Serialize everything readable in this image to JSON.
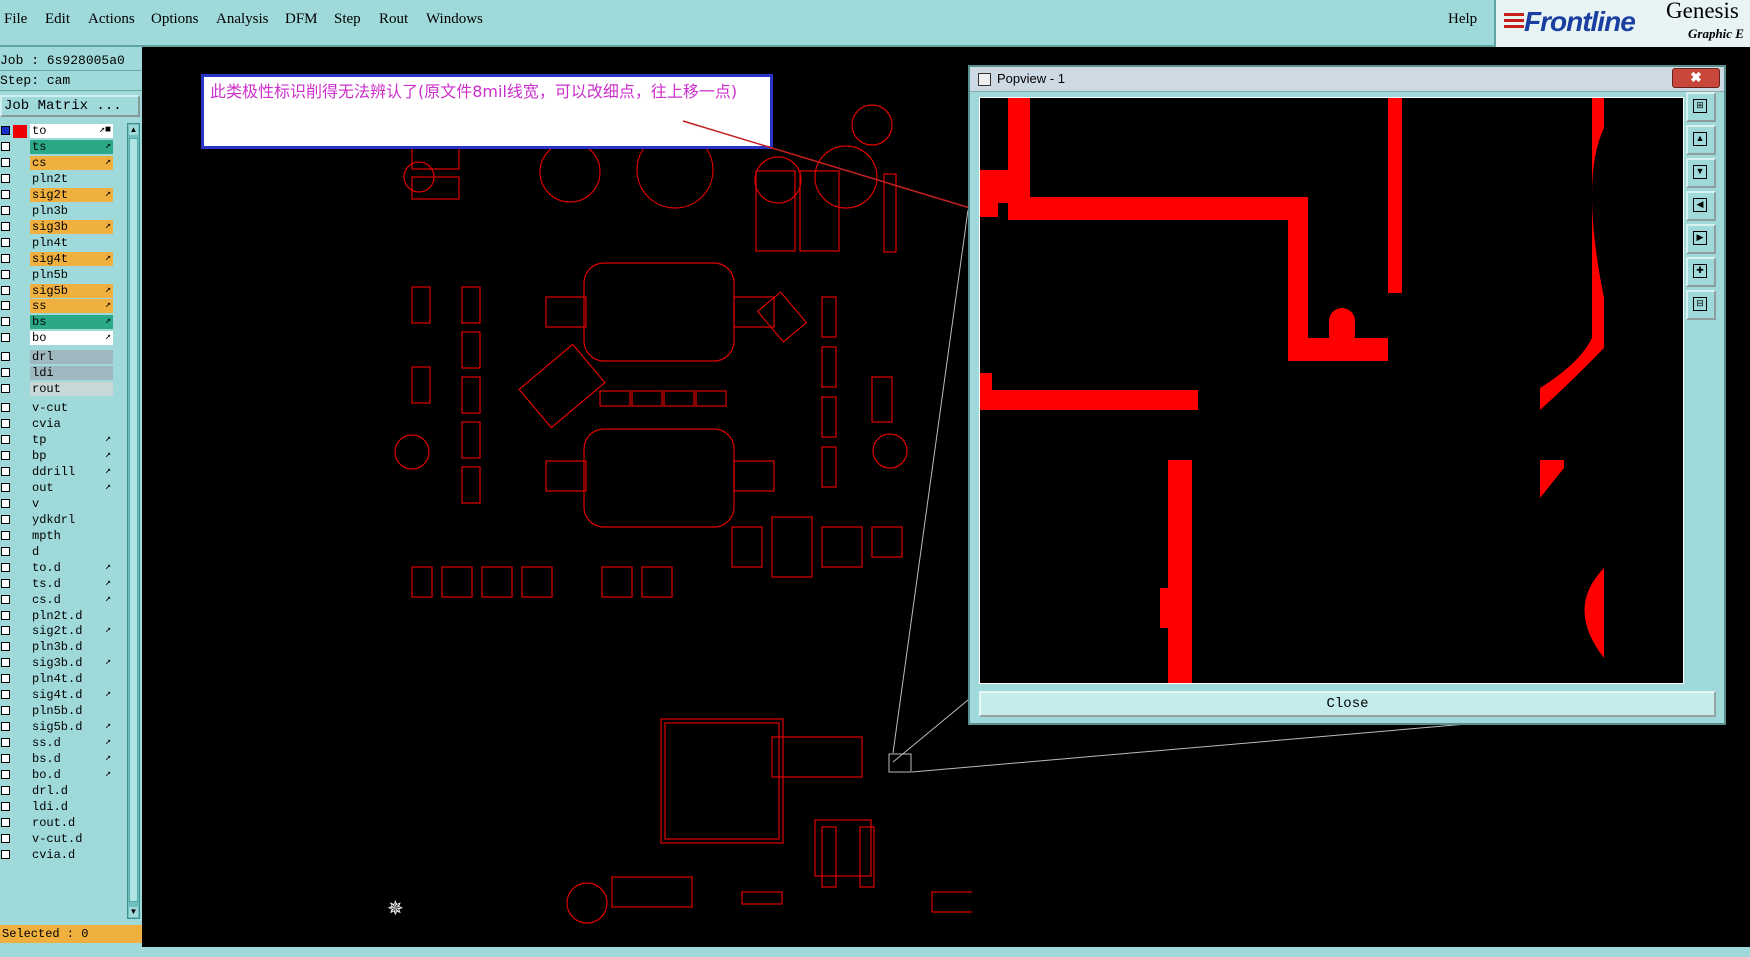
{
  "menubar": {
    "items": [
      "File",
      "Edit",
      "Actions",
      "Options",
      "Analysis",
      "DFM",
      "Step",
      "Rout",
      "Windows"
    ],
    "help": "Help",
    "brand": "Frontline",
    "product": "Genesis",
    "product_sub": "Graphic E"
  },
  "left_panel": {
    "job": "Job : 6s928005a0",
    "step": "Step: cam",
    "job_matrix": "Job Matrix ...",
    "selected": "Selected : 0",
    "layers": [
      {
        "name": "to",
        "color": "#ffffff",
        "active": true,
        "arrow": "↗■"
      },
      {
        "name": "ts",
        "color": "#2aa888",
        "arrow": "↗"
      },
      {
        "name": "cs",
        "color": "#f0b040",
        "arrow": "↗"
      },
      {
        "name": "pln2t",
        "color": "#9fd9d9",
        "arrow": ""
      },
      {
        "name": "sig2t",
        "color": "#f0b040",
        "arrow": "↗"
      },
      {
        "name": "pln3b",
        "color": "#9fd9d9",
        "arrow": ""
      },
      {
        "name": "sig3b",
        "color": "#f0b040",
        "arrow": "↗"
      },
      {
        "name": "pln4t",
        "color": "#9fd9d9",
        "arrow": ""
      },
      {
        "name": "sig4t",
        "color": "#f0b040",
        "arrow": "↗"
      },
      {
        "name": "pln5b",
        "color": "#9fd9d9",
        "arrow": ""
      },
      {
        "name": "sig5b",
        "color": "#f0b040",
        "arrow": "↗"
      },
      {
        "name": "ss",
        "color": "#f0b040",
        "arrow": "↗"
      },
      {
        "name": "bs",
        "color": "#2aa888",
        "arrow": "↗"
      },
      {
        "name": "bo",
        "color": "#ffffff",
        "arrow": "↗"
      },
      {
        "name": "drl",
        "color": "#9fb8c0",
        "arrow": ""
      },
      {
        "name": "ldi",
        "color": "#9fb8c0",
        "arrow": ""
      },
      {
        "name": "rout",
        "color": "#c8d8d8",
        "arrow": ""
      },
      {
        "name": "v-cut",
        "color": "#9fd9d9",
        "arrow": ""
      },
      {
        "name": "cvia",
        "color": "#9fd9d9",
        "arrow": ""
      },
      {
        "name": "tp",
        "color": "#9fd9d9",
        "arrow": "↗"
      },
      {
        "name": "bp",
        "color": "#9fd9d9",
        "arrow": "↗"
      },
      {
        "name": "ddrill",
        "color": "#9fd9d9",
        "arrow": "↗"
      },
      {
        "name": "out",
        "color": "#9fd9d9",
        "arrow": "↗"
      },
      {
        "name": "v",
        "color": "#9fd9d9",
        "arrow": ""
      },
      {
        "name": "ydkdrl",
        "color": "#9fd9d9",
        "arrow": ""
      },
      {
        "name": "mpth",
        "color": "#9fd9d9",
        "arrow": ""
      },
      {
        "name": "d",
        "color": "#9fd9d9",
        "arrow": ""
      },
      {
        "name": "to.d",
        "color": "#9fd9d9",
        "arrow": "↗"
      },
      {
        "name": "ts.d",
        "color": "#9fd9d9",
        "arrow": "↗"
      },
      {
        "name": "cs.d",
        "color": "#9fd9d9",
        "arrow": "↗"
      },
      {
        "name": "pln2t.d",
        "color": "#9fd9d9",
        "arrow": ""
      },
      {
        "name": "sig2t.d",
        "color": "#9fd9d9",
        "arrow": "↗"
      },
      {
        "name": "pln3b.d",
        "color": "#9fd9d9",
        "arrow": ""
      },
      {
        "name": "sig3b.d",
        "color": "#9fd9d9",
        "arrow": "↗"
      },
      {
        "name": "pln4t.d",
        "color": "#9fd9d9",
        "arrow": ""
      },
      {
        "name": "sig4t.d",
        "color": "#9fd9d9",
        "arrow": "↗"
      },
      {
        "name": "pln5b.d",
        "color": "#9fd9d9",
        "arrow": ""
      },
      {
        "name": "sig5b.d",
        "color": "#9fd9d9",
        "arrow": "↗"
      },
      {
        "name": "ss.d",
        "color": "#9fd9d9",
        "arrow": "↗"
      },
      {
        "name": "bs.d",
        "color": "#9fd9d9",
        "arrow": "↗"
      },
      {
        "name": "bo.d",
        "color": "#9fd9d9",
        "arrow": "↗"
      },
      {
        "name": "drl.d",
        "color": "#9fd9d9",
        "arrow": ""
      },
      {
        "name": "ldi.d",
        "color": "#9fd9d9",
        "arrow": ""
      },
      {
        "name": "rout.d",
        "color": "#9fd9d9",
        "arrow": ""
      },
      {
        "name": "v-cut.d",
        "color": "#9fd9d9",
        "arrow": ""
      },
      {
        "name": "cvia.d",
        "color": "#9fd9d9",
        "arrow": ""
      }
    ]
  },
  "note": {
    "text": "此类极性标识削得无法辨认了(原文件8mil线宽，可以改细点，往上移一点)"
  },
  "popview": {
    "title": "Popview - 1",
    "close_label": "Close",
    "close_x": "✖"
  },
  "colors": {
    "panel": "#9fd9d9",
    "trace": "#ff0000",
    "note_text": "#cc2fcc",
    "note_border": "#2a35c8"
  }
}
